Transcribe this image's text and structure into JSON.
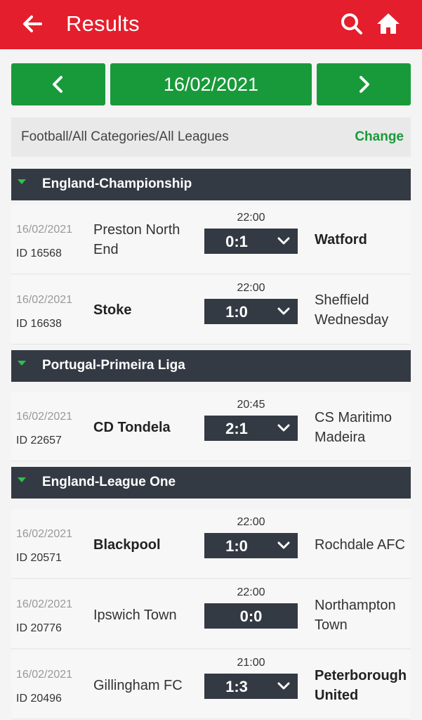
{
  "header": {
    "title": "Results",
    "back_icon": "back-arrow-icon",
    "search_icon": "search-icon",
    "home_icon": "home-icon"
  },
  "date_nav": {
    "date": "16/02/2021",
    "prev_icon": "chevron-left-icon",
    "next_icon": "chevron-right-icon"
  },
  "filter": {
    "path": "Football/All Categories/All Leagues",
    "change_label": "Change"
  },
  "colors": {
    "header": "#e41e2c",
    "accent": "#199a3a",
    "dark": "#343a44"
  },
  "leagues": [
    {
      "name": "England-Championship",
      "matches": [
        {
          "date": "16/02/2021",
          "id": "ID 16568",
          "home": "Preston North End",
          "away": "Watford",
          "time": "22:00",
          "score": "0:1",
          "winner": "away"
        },
        {
          "date": "16/02/2021",
          "id": "ID 16638",
          "home": "Stoke",
          "away": "Sheffield Wednesday",
          "time": "22:00",
          "score": "1:0",
          "winner": "home"
        }
      ]
    },
    {
      "name": "Portugal-Primeira Liga",
      "matches": [
        {
          "date": "16/02/2021",
          "id": "ID 22657",
          "home": "CD Tondela",
          "away": "CS Maritimo Madeira",
          "time": "20:45",
          "score": "2:1",
          "winner": "home"
        }
      ]
    },
    {
      "name": "England-League One",
      "matches": [
        {
          "date": "16/02/2021",
          "id": "ID 20571",
          "home": "Blackpool",
          "away": "Rochdale AFC",
          "time": "22:00",
          "score": "1:0",
          "winner": "home"
        },
        {
          "date": "16/02/2021",
          "id": "ID 20776",
          "home": "Ipswich Town",
          "away": "Northampton Town",
          "time": "22:00",
          "score": "0:0",
          "winner": "none"
        },
        {
          "date": "16/02/2021",
          "id": "ID 20496",
          "home": "Gillingham FC",
          "away": "Peterborough United",
          "time": "21:00",
          "score": "1:3",
          "winner": "away"
        }
      ]
    }
  ]
}
